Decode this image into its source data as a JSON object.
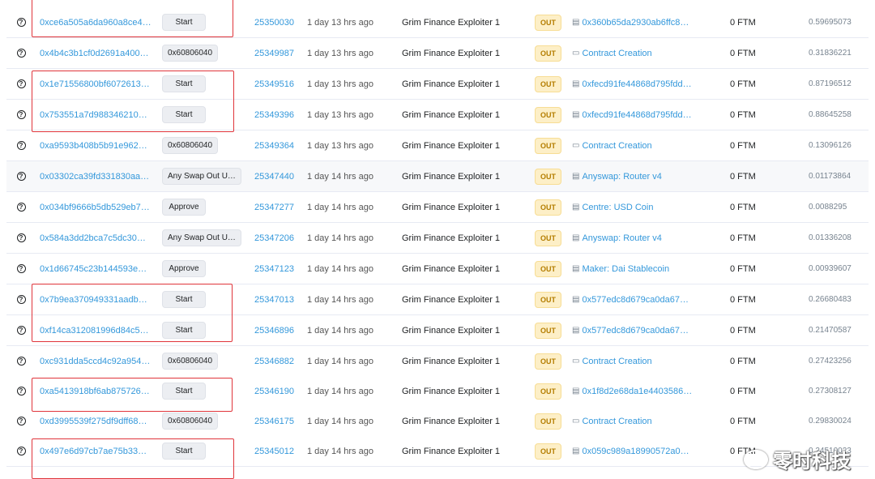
{
  "rows": [
    {
      "hash": "0xce6a505a6da960a8ce4…",
      "method": "Start",
      "block": "25350030",
      "age": "1 day 13 hrs ago",
      "from": "Grim Finance Exploiter 1",
      "dir": "OUT",
      "to": "0x360b65da2930ab6ffc8…",
      "to_icon": "file-icon",
      "value": "0 FTM",
      "fee": "0.59695073"
    },
    {
      "hash": "0x4b4c3b1cf0d2691a400…",
      "method": "0x60806040",
      "block": "25349987",
      "age": "1 day 13 hrs ago",
      "from": "Grim Finance Exploiter 1",
      "dir": "OUT",
      "to": "Contract Creation",
      "to_icon": "contract-icon",
      "value": "0 FTM",
      "fee": "0.31836221"
    },
    {
      "hash": "0x1e71556800bf6072613…",
      "method": "Start",
      "block": "25349516",
      "age": "1 day 13 hrs ago",
      "from": "Grim Finance Exploiter 1",
      "dir": "OUT",
      "to": "0xfecd91fe44868d795fdd…",
      "to_icon": "file-icon",
      "value": "0 FTM",
      "fee": "0.87196512"
    },
    {
      "hash": "0x753551a7d988346210…",
      "method": "Start",
      "block": "25349396",
      "age": "1 day 13 hrs ago",
      "from": "Grim Finance Exploiter 1",
      "dir": "OUT",
      "to": "0xfecd91fe44868d795fdd…",
      "to_icon": "file-icon",
      "value": "0 FTM",
      "fee": "0.88645258"
    },
    {
      "hash": "0xa9593b408b5b91e962…",
      "method": "0x60806040",
      "block": "25349364",
      "age": "1 day 13 hrs ago",
      "from": "Grim Finance Exploiter 1",
      "dir": "OUT",
      "to": "Contract Creation",
      "to_icon": "contract-icon",
      "value": "0 FTM",
      "fee": "0.13096126"
    },
    {
      "hash": "0x03302ca39fd331830aa…",
      "method": "Any Swap Out Und…",
      "block": "25347440",
      "age": "1 day 14 hrs ago",
      "from": "Grim Finance Exploiter 1",
      "dir": "OUT",
      "to": "Anyswap: Router v4",
      "to_icon": "file-icon",
      "value": "0 FTM",
      "fee": "0.01173864"
    },
    {
      "hash": "0x034bf9666b5db529eb7…",
      "method": "Approve",
      "block": "25347277",
      "age": "1 day 14 hrs ago",
      "from": "Grim Finance Exploiter 1",
      "dir": "OUT",
      "to": "Centre: USD Coin",
      "to_icon": "file-icon",
      "value": "0 FTM",
      "fee": "0.0088295"
    },
    {
      "hash": "0x584a3dd2bca7c5dc30…",
      "method": "Any Swap Out Und…",
      "block": "25347206",
      "age": "1 day 14 hrs ago",
      "from": "Grim Finance Exploiter 1",
      "dir": "OUT",
      "to": "Anyswap: Router v4",
      "to_icon": "file-icon",
      "value": "0 FTM",
      "fee": "0.01336208"
    },
    {
      "hash": "0x1d66745c23b144593e…",
      "method": "Approve",
      "block": "25347123",
      "age": "1 day 14 hrs ago",
      "from": "Grim Finance Exploiter 1",
      "dir": "OUT",
      "to": "Maker: Dai Stablecoin",
      "to_icon": "file-icon",
      "value": "0 FTM",
      "fee": "0.00939607"
    },
    {
      "hash": "0x7b9ea370949331aadb…",
      "method": "Start",
      "block": "25347013",
      "age": "1 day 14 hrs ago",
      "from": "Grim Finance Exploiter 1",
      "dir": "OUT",
      "to": "0x577edc8d679ca0da67…",
      "to_icon": "file-icon",
      "value": "0 FTM",
      "fee": "0.26680483"
    },
    {
      "hash": "0xf14ca312081996d84c5…",
      "method": "Start",
      "block": "25346896",
      "age": "1 day 14 hrs ago",
      "from": "Grim Finance Exploiter 1",
      "dir": "OUT",
      "to": "0x577edc8d679ca0da67…",
      "to_icon": "file-icon",
      "value": "0 FTM",
      "fee": "0.21470587"
    },
    {
      "hash": "0xc931dda5ccd4c92a954…",
      "method": "0x60806040",
      "block": "25346882",
      "age": "1 day 14 hrs ago",
      "from": "Grim Finance Exploiter 1",
      "dir": "OUT",
      "to": "Contract Creation",
      "to_icon": "contract-icon",
      "value": "0 FTM",
      "fee": "0.27423256"
    },
    {
      "hash": "0xa5413918bf6ab875726…",
      "method": "Start",
      "block": "25346190",
      "age": "1 day 14 hrs ago",
      "from": "Grim Finance Exploiter 1",
      "dir": "OUT",
      "to": "0x1f8d2e68da1e4403586…",
      "to_icon": "file-icon",
      "value": "0 FTM",
      "fee": "0.27308127"
    },
    {
      "hash": "0xd3995539f275df9dff68…",
      "method": "0x60806040",
      "block": "25346175",
      "age": "1 day 14 hrs ago",
      "from": "Grim Finance Exploiter 1",
      "dir": "OUT",
      "to": "Contract Creation",
      "to_icon": "contract-icon",
      "value": "0 FTM",
      "fee": "0.29830024"
    },
    {
      "hash": "0x497e6d97cb7ae75b33…",
      "method": "Start",
      "block": "25345012",
      "age": "1 day 14 hrs ago",
      "from": "Grim Finance Exploiter 1",
      "dir": "OUT",
      "to": "0x059c989a18990572a0…",
      "to_icon": "file-icon",
      "value": "0 FTM",
      "fee": "0.24510023"
    }
  ],
  "watermark": {
    "text": "零时科技"
  },
  "colors": {
    "link": "#3498db",
    "out_badge_bg": "#fdefc7",
    "out_badge_text": "#b47d00",
    "highlight_box": "#e0353b"
  }
}
